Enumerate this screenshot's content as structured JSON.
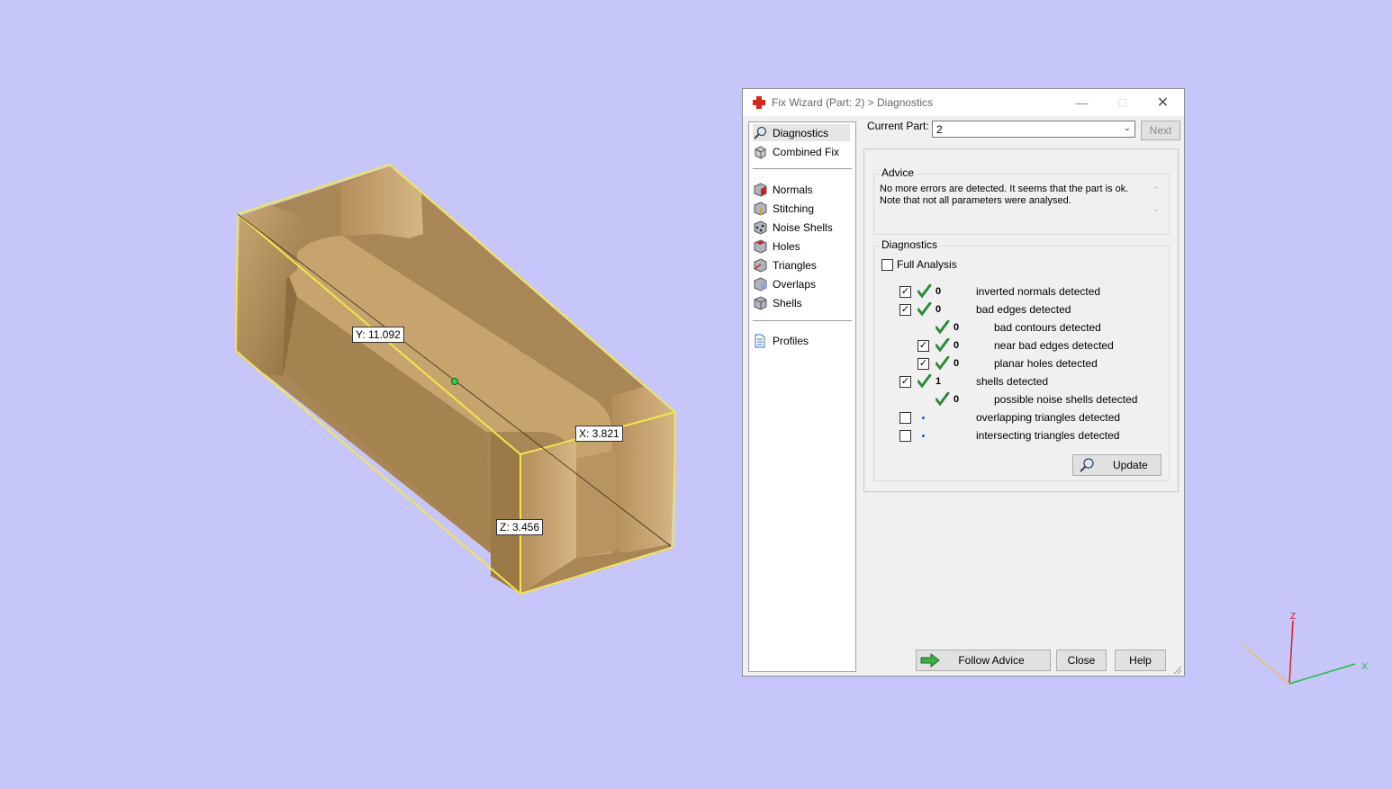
{
  "viewport": {
    "labels": {
      "y": "Y: 11.092",
      "x": "X: 3.821",
      "z": "Z: 3.456"
    },
    "axes": {
      "z": "Z",
      "x": "X",
      "y": "Y"
    }
  },
  "dialog": {
    "title": "Fix Wizard (Part: 2) > Diagnostics",
    "nav": {
      "top": [
        "Diagnostics",
        "Combined Fix"
      ],
      "tools": [
        "Normals",
        "Stitching",
        "Noise Shells",
        "Holes",
        "Triangles",
        "Overlaps",
        "Shells"
      ],
      "bottom": [
        "Profiles"
      ]
    },
    "current_part_label": "Current Part:",
    "current_part_value": "2",
    "next_label": "Next",
    "advice": {
      "title": "Advice",
      "text_line1": "No more errors are detected. It seems that the part is ok.",
      "text_line2": "Note that not all parameters were analysed."
    },
    "diagnostics": {
      "title": "Diagnostics",
      "full_analysis": "Full Analysis",
      "full_analysis_checked": false,
      "rows": [
        {
          "checked": true,
          "status": "ok",
          "count": "0",
          "label": "inverted normals detected"
        },
        {
          "checked": true,
          "status": "ok",
          "count": "0",
          "label": "bad edges detected"
        },
        {
          "checked": null,
          "status": "ok",
          "count": "0",
          "label": "bad contours detected"
        },
        {
          "checked": true,
          "status": "ok",
          "count": "0",
          "label": "near bad edges detected"
        },
        {
          "checked": true,
          "status": "ok",
          "count": "0",
          "label": "planar holes detected"
        },
        {
          "checked": true,
          "status": "ok",
          "count": "1",
          "label": "shells detected"
        },
        {
          "checked": null,
          "status": "ok",
          "count": "0",
          "label": "possible noise shells detected"
        },
        {
          "checked": false,
          "status": "pending",
          "count": "",
          "label": "overlapping triangles detected"
        },
        {
          "checked": false,
          "status": "pending",
          "count": "",
          "label": "intersecting triangles detected"
        }
      ],
      "update_label": "Update"
    },
    "buttons": {
      "follow_advice": "Follow Advice",
      "close": "Close",
      "help": "Help"
    },
    "colors": {
      "check_green": "#2e8b3a",
      "accent_red": "#d9261c"
    }
  }
}
